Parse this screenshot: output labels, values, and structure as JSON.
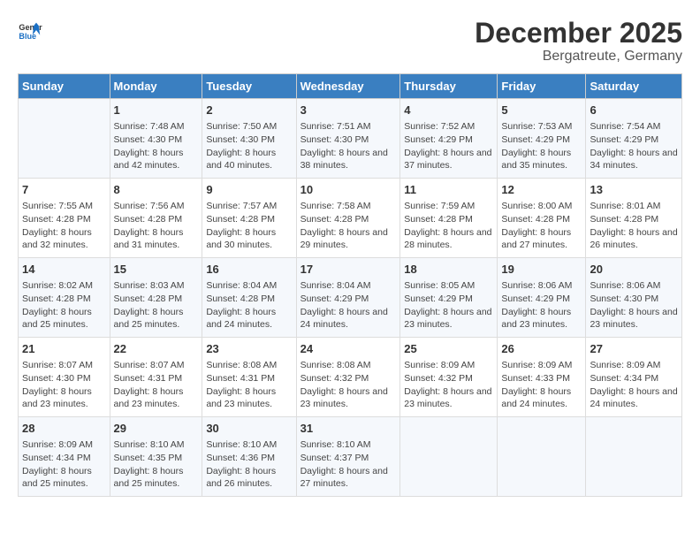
{
  "header": {
    "logo_line1": "General",
    "logo_line2": "Blue",
    "title": "December 2025",
    "subtitle": "Bergatreute, Germany"
  },
  "columns": [
    "Sunday",
    "Monday",
    "Tuesday",
    "Wednesday",
    "Thursday",
    "Friday",
    "Saturday"
  ],
  "weeks": [
    [
      {
        "day": "",
        "sunrise": "",
        "sunset": "",
        "daylight": ""
      },
      {
        "day": "1",
        "sunrise": "Sunrise: 7:48 AM",
        "sunset": "Sunset: 4:30 PM",
        "daylight": "Daylight: 8 hours and 42 minutes."
      },
      {
        "day": "2",
        "sunrise": "Sunrise: 7:50 AM",
        "sunset": "Sunset: 4:30 PM",
        "daylight": "Daylight: 8 hours and 40 minutes."
      },
      {
        "day": "3",
        "sunrise": "Sunrise: 7:51 AM",
        "sunset": "Sunset: 4:30 PM",
        "daylight": "Daylight: 8 hours and 38 minutes."
      },
      {
        "day": "4",
        "sunrise": "Sunrise: 7:52 AM",
        "sunset": "Sunset: 4:29 PM",
        "daylight": "Daylight: 8 hours and 37 minutes."
      },
      {
        "day": "5",
        "sunrise": "Sunrise: 7:53 AM",
        "sunset": "Sunset: 4:29 PM",
        "daylight": "Daylight: 8 hours and 35 minutes."
      },
      {
        "day": "6",
        "sunrise": "Sunrise: 7:54 AM",
        "sunset": "Sunset: 4:29 PM",
        "daylight": "Daylight: 8 hours and 34 minutes."
      }
    ],
    [
      {
        "day": "7",
        "sunrise": "Sunrise: 7:55 AM",
        "sunset": "Sunset: 4:28 PM",
        "daylight": "Daylight: 8 hours and 32 minutes."
      },
      {
        "day": "8",
        "sunrise": "Sunrise: 7:56 AM",
        "sunset": "Sunset: 4:28 PM",
        "daylight": "Daylight: 8 hours and 31 minutes."
      },
      {
        "day": "9",
        "sunrise": "Sunrise: 7:57 AM",
        "sunset": "Sunset: 4:28 PM",
        "daylight": "Daylight: 8 hours and 30 minutes."
      },
      {
        "day": "10",
        "sunrise": "Sunrise: 7:58 AM",
        "sunset": "Sunset: 4:28 PM",
        "daylight": "Daylight: 8 hours and 29 minutes."
      },
      {
        "day": "11",
        "sunrise": "Sunrise: 7:59 AM",
        "sunset": "Sunset: 4:28 PM",
        "daylight": "Daylight: 8 hours and 28 minutes."
      },
      {
        "day": "12",
        "sunrise": "Sunrise: 8:00 AM",
        "sunset": "Sunset: 4:28 PM",
        "daylight": "Daylight: 8 hours and 27 minutes."
      },
      {
        "day": "13",
        "sunrise": "Sunrise: 8:01 AM",
        "sunset": "Sunset: 4:28 PM",
        "daylight": "Daylight: 8 hours and 26 minutes."
      }
    ],
    [
      {
        "day": "14",
        "sunrise": "Sunrise: 8:02 AM",
        "sunset": "Sunset: 4:28 PM",
        "daylight": "Daylight: 8 hours and 25 minutes."
      },
      {
        "day": "15",
        "sunrise": "Sunrise: 8:03 AM",
        "sunset": "Sunset: 4:28 PM",
        "daylight": "Daylight: 8 hours and 25 minutes."
      },
      {
        "day": "16",
        "sunrise": "Sunrise: 8:04 AM",
        "sunset": "Sunset: 4:28 PM",
        "daylight": "Daylight: 8 hours and 24 minutes."
      },
      {
        "day": "17",
        "sunrise": "Sunrise: 8:04 AM",
        "sunset": "Sunset: 4:29 PM",
        "daylight": "Daylight: 8 hours and 24 minutes."
      },
      {
        "day": "18",
        "sunrise": "Sunrise: 8:05 AM",
        "sunset": "Sunset: 4:29 PM",
        "daylight": "Daylight: 8 hours and 23 minutes."
      },
      {
        "day": "19",
        "sunrise": "Sunrise: 8:06 AM",
        "sunset": "Sunset: 4:29 PM",
        "daylight": "Daylight: 8 hours and 23 minutes."
      },
      {
        "day": "20",
        "sunrise": "Sunrise: 8:06 AM",
        "sunset": "Sunset: 4:30 PM",
        "daylight": "Daylight: 8 hours and 23 minutes."
      }
    ],
    [
      {
        "day": "21",
        "sunrise": "Sunrise: 8:07 AM",
        "sunset": "Sunset: 4:30 PM",
        "daylight": "Daylight: 8 hours and 23 minutes."
      },
      {
        "day": "22",
        "sunrise": "Sunrise: 8:07 AM",
        "sunset": "Sunset: 4:31 PM",
        "daylight": "Daylight: 8 hours and 23 minutes."
      },
      {
        "day": "23",
        "sunrise": "Sunrise: 8:08 AM",
        "sunset": "Sunset: 4:31 PM",
        "daylight": "Daylight: 8 hours and 23 minutes."
      },
      {
        "day": "24",
        "sunrise": "Sunrise: 8:08 AM",
        "sunset": "Sunset: 4:32 PM",
        "daylight": "Daylight: 8 hours and 23 minutes."
      },
      {
        "day": "25",
        "sunrise": "Sunrise: 8:09 AM",
        "sunset": "Sunset: 4:32 PM",
        "daylight": "Daylight: 8 hours and 23 minutes."
      },
      {
        "day": "26",
        "sunrise": "Sunrise: 8:09 AM",
        "sunset": "Sunset: 4:33 PM",
        "daylight": "Daylight: 8 hours and 24 minutes."
      },
      {
        "day": "27",
        "sunrise": "Sunrise: 8:09 AM",
        "sunset": "Sunset: 4:34 PM",
        "daylight": "Daylight: 8 hours and 24 minutes."
      }
    ],
    [
      {
        "day": "28",
        "sunrise": "Sunrise: 8:09 AM",
        "sunset": "Sunset: 4:34 PM",
        "daylight": "Daylight: 8 hours and 25 minutes."
      },
      {
        "day": "29",
        "sunrise": "Sunrise: 8:10 AM",
        "sunset": "Sunset: 4:35 PM",
        "daylight": "Daylight: 8 hours and 25 minutes."
      },
      {
        "day": "30",
        "sunrise": "Sunrise: 8:10 AM",
        "sunset": "Sunset: 4:36 PM",
        "daylight": "Daylight: 8 hours and 26 minutes."
      },
      {
        "day": "31",
        "sunrise": "Sunrise: 8:10 AM",
        "sunset": "Sunset: 4:37 PM",
        "daylight": "Daylight: 8 hours and 27 minutes."
      },
      {
        "day": "",
        "sunrise": "",
        "sunset": "",
        "daylight": ""
      },
      {
        "day": "",
        "sunrise": "",
        "sunset": "",
        "daylight": ""
      },
      {
        "day": "",
        "sunrise": "",
        "sunset": "",
        "daylight": ""
      }
    ]
  ]
}
